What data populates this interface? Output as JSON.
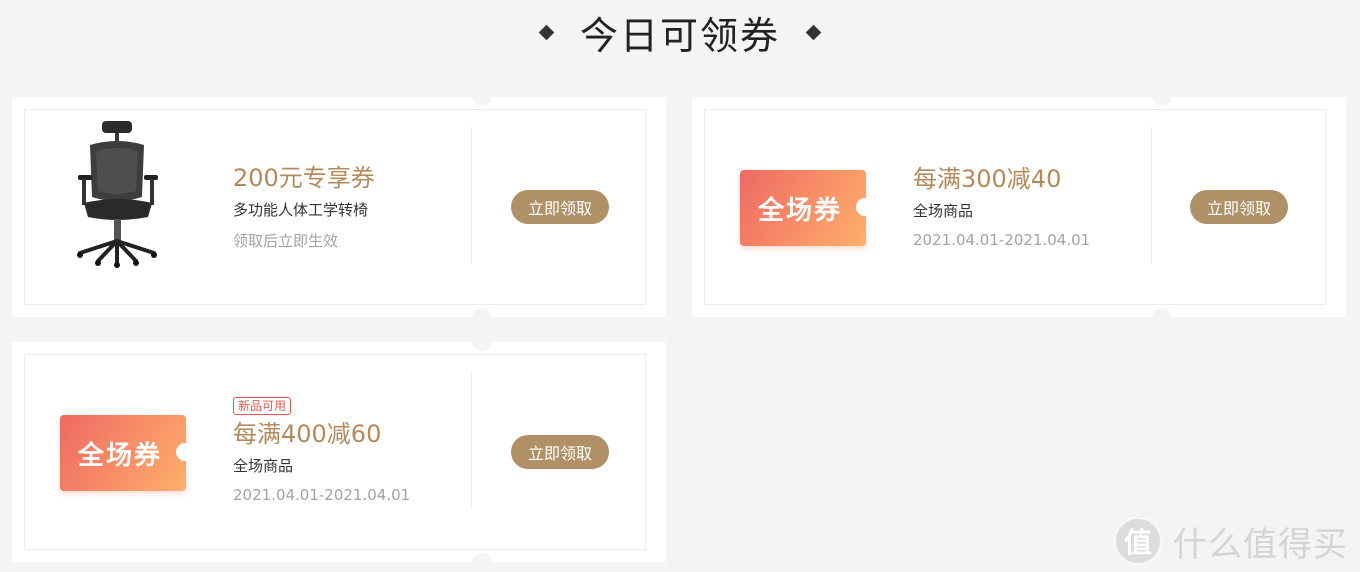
{
  "header": {
    "title": "今日可领券"
  },
  "coupons": [
    {
      "main": "200元专享券",
      "sub": "多功能人体工学转椅",
      "note": "领取后立即生效",
      "button": "立即领取",
      "image": "office-chair"
    },
    {
      "badge": "全场券",
      "main": "每满300减40",
      "sub": "全场商品",
      "note": "2021.04.01-2021.04.01",
      "button": "立即领取"
    },
    {
      "badge": "全场券",
      "tag": "新品可用",
      "main": "每满400减60",
      "sub": "全场商品",
      "note": "2021.04.01-2021.04.01",
      "button": "立即领取"
    }
  ],
  "watermark": {
    "logo": "值",
    "text": "什么值得买"
  },
  "colors": {
    "background": "#f4f4f5",
    "accent_text": "#b48a5c",
    "button": "#b09066",
    "badge_gradient_start": "#ee6a64",
    "badge_gradient_end": "#fcb06c",
    "tag": "#e8594e"
  }
}
